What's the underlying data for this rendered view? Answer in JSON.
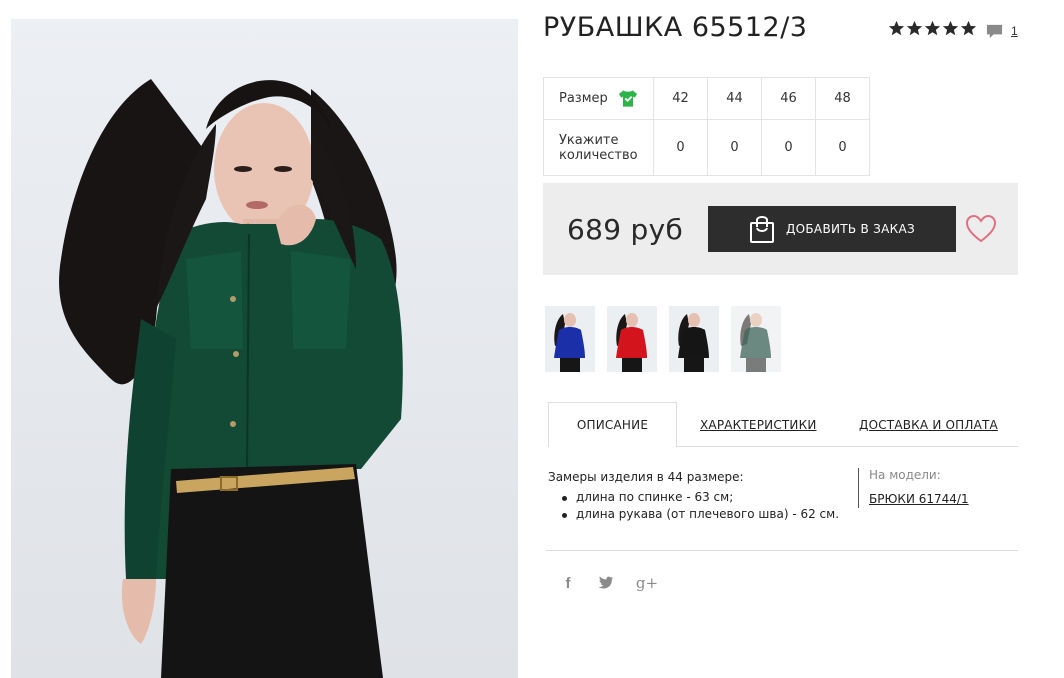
{
  "product": {
    "title": "РУБАШКА 65512/3",
    "rating_stars": 5,
    "comment_count": "1",
    "price": "689 руб",
    "add_to_order_label": "ДОБАВИТЬ В ЗАКАЗ"
  },
  "size_table": {
    "size_label": "Размер",
    "qty_label": "Укажите количество",
    "sizes": [
      "42",
      "44",
      "46",
      "48"
    ],
    "quantities": [
      "0",
      "0",
      "0",
      "0"
    ]
  },
  "thumbnails": [
    {
      "color": "#1a2fa8",
      "name": "blue"
    },
    {
      "color": "#d3141d",
      "name": "red"
    },
    {
      "color": "#151515",
      "name": "black"
    },
    {
      "color": "#3e6659",
      "name": "green"
    }
  ],
  "tabs": {
    "description": "ОПИСАНИЕ",
    "characteristics": "ХАРАКТЕРИСТИКИ",
    "delivery": "ДОСТАВКА И ОПЛАТА"
  },
  "description": {
    "intro": "Замеры изделия в 44 размере:",
    "items": [
      "длина по спинке - 63 см;",
      "длина рукава (от плечевого шва) - 62 см."
    ]
  },
  "on_model": {
    "label": "На модели:",
    "link": "БРЮКИ 61744/1"
  },
  "social": {
    "facebook": "f",
    "twitter": "t",
    "gplus": "g+"
  },
  "colors": {
    "accent_green": "#2db34a",
    "button_dark": "#2d2d2d",
    "heart_pink": "#e0707e",
    "shirt_green": "#124a36"
  }
}
